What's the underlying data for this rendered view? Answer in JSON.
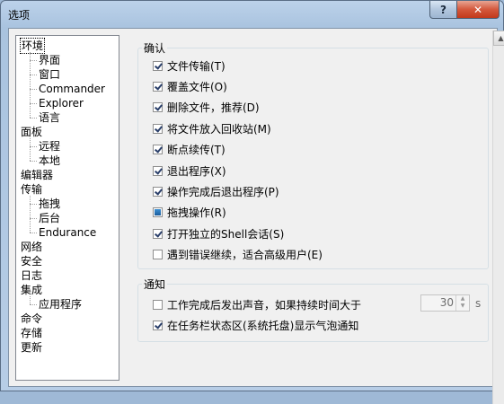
{
  "window": {
    "title": "选项"
  },
  "tree": {
    "items": [
      {
        "label": "环境",
        "level": 0,
        "selected": true
      },
      {
        "label": "界面",
        "level": 1
      },
      {
        "label": "窗口",
        "level": 1
      },
      {
        "label": "Commander",
        "level": 1
      },
      {
        "label": "Explorer",
        "level": 1
      },
      {
        "label": "语言",
        "level": 1
      },
      {
        "label": "面板",
        "level": 0
      },
      {
        "label": "远程",
        "level": 1
      },
      {
        "label": "本地",
        "level": 1
      },
      {
        "label": "编辑器",
        "level": 0
      },
      {
        "label": "传输",
        "level": 0
      },
      {
        "label": "拖拽",
        "level": 1
      },
      {
        "label": "后台",
        "level": 1
      },
      {
        "label": "Endurance",
        "level": 1
      },
      {
        "label": "网络",
        "level": 0
      },
      {
        "label": "安全",
        "level": 0
      },
      {
        "label": "日志",
        "level": 0
      },
      {
        "label": "集成",
        "level": 0
      },
      {
        "label": "应用程序",
        "level": 1
      },
      {
        "label": "命令",
        "level": 0
      },
      {
        "label": "存储",
        "level": 0
      },
      {
        "label": "更新",
        "level": 0
      }
    ]
  },
  "confirm": {
    "title": "确认",
    "options": [
      {
        "label": "文件传输(T)",
        "state": "checked"
      },
      {
        "label": "覆盖文件(O)",
        "state": "checked"
      },
      {
        "label": "删除文件，推荐(D)",
        "state": "checked"
      },
      {
        "label": "将文件放入回收站(M)",
        "state": "checked"
      },
      {
        "label": "断点续传(T)",
        "state": "checked"
      },
      {
        "label": "退出程序(X)",
        "state": "checked"
      },
      {
        "label": "操作完成后退出程序(P)",
        "state": "checked"
      },
      {
        "label": "拖拽操作(R)",
        "state": "mixed"
      },
      {
        "label": "打开独立的Shell会话(S)",
        "state": "checked"
      },
      {
        "label": "遇到错误继续，适合高级用户(E)",
        "state": "unchecked"
      }
    ]
  },
  "notify": {
    "title": "通知",
    "options": [
      {
        "label": "工作完成后发出声音，如果持续时间大于",
        "state": "unchecked"
      },
      {
        "label": "在任务栏状态区(系统托盘)显示气泡通知",
        "state": "checked"
      }
    ],
    "spin_value": "30",
    "spin_unit": "s"
  }
}
